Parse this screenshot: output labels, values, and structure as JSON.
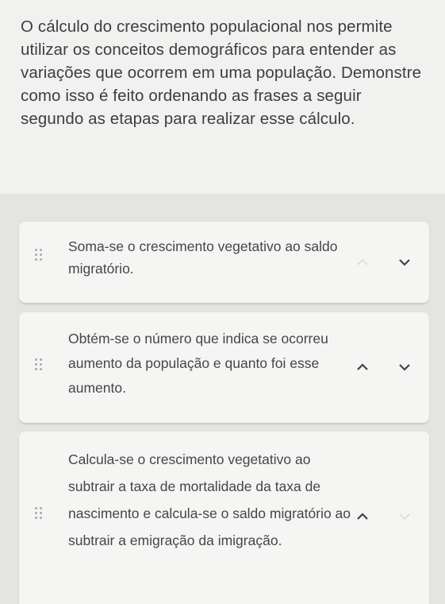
{
  "question": {
    "text": "O cálculo do crescimento populacional nos permite utilizar os conceitos demográficos para entender as variações que ocorrem em uma população. Demonstre como isso é feito ordenando as frases a seguir segundo as etapas para realizar esse cálculo."
  },
  "items": [
    {
      "text": "Soma-se o crescimento vegetativo ao saldo migratório.",
      "up_icon": "chevron-up-icon",
      "down_icon": "chevron-down-icon",
      "up_enabled": false,
      "down_enabled": true
    },
    {
      "text": "Obtém-se o número que indica se ocorreu aumento da população e quanto foi esse aumento.",
      "up_icon": "chevron-up-icon",
      "down_icon": "chevron-down-icon",
      "up_enabled": true,
      "down_enabled": true
    },
    {
      "text": "Calcula-se o crescimento vegetativo ao subtrair a taxa de mortalidade da taxa de nascimento e calcula-se o saldo migratório ao subtrair a emigração da imigração.",
      "up_icon": "chevron-up-icon",
      "down_icon": "chevron-down-icon",
      "up_enabled": true,
      "down_enabled": false
    }
  ],
  "colors": {
    "question_bg": "#f1f1ef",
    "list_bg": "#e4e5e2",
    "card_bg": "#f5f5f3",
    "text": "#3c3e41",
    "arrow_active": "#3f4246",
    "arrow_disabled": "#d8d9db"
  }
}
